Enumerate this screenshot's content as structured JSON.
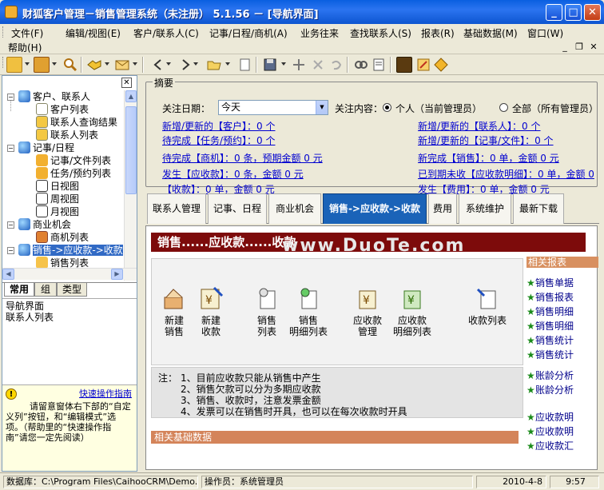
{
  "window": {
    "title": "财狐客户管理－销售管理系统（未注册） 5.1.56 － [导航界面]",
    "btn_min": "_",
    "btn_max": "□",
    "btn_close": "✕"
  },
  "menu": {
    "items": [
      "文件(F)",
      "编辑/视图(E)",
      "客户/联系人(C)",
      "记事/日程/商机(A)",
      "业务往来",
      "查找联系人(S)",
      "报表(R)",
      "基础数据(M)",
      "窗口(W)"
    ],
    "help": "帮助(H)",
    "mdi_min": "_",
    "mdi_restore": "❐",
    "mdi_close": "✕"
  },
  "left_panel": {
    "close": "✕",
    "tree": [
      {
        "label": "客户、联系人",
        "level": 0,
        "expanded": true,
        "icon": "globe-icon"
      },
      {
        "label": "客户列表",
        "level": 1,
        "icon": "house-icon"
      },
      {
        "label": "联系人查询结果",
        "level": 1,
        "icon": "card-icon"
      },
      {
        "label": "联系人列表",
        "level": 1,
        "icon": "card-icon"
      },
      {
        "label": "记事/日程",
        "level": 0,
        "expanded": true,
        "icon": "globe-icon"
      },
      {
        "label": "记事/文件列表",
        "level": 1,
        "icon": "pencil-icon"
      },
      {
        "label": "任务/预约列表",
        "level": 1,
        "icon": "pencil-icon"
      },
      {
        "label": "日视图",
        "level": 1,
        "icon": "calendar-icon"
      },
      {
        "label": "周视图",
        "level": 1,
        "icon": "calendar-icon"
      },
      {
        "label": "月视图",
        "level": 1,
        "icon": "calendar-icon"
      },
      {
        "label": "商业机会",
        "level": 0,
        "expanded": true,
        "icon": "globe-icon"
      },
      {
        "label": "商机列表",
        "level": 1,
        "icon": "chart-icon"
      },
      {
        "label": "销售->应收款->收款",
        "level": 0,
        "expanded": true,
        "selected": true,
        "icon": "globe-icon"
      },
      {
        "label": "销售列表",
        "level": 1,
        "icon": "hand-icon"
      }
    ],
    "tabs": [
      "常用",
      "组",
      "类型"
    ],
    "nav_items": [
      "导航界面",
      "联系人列表"
    ],
    "hint_link": "快速操作指南",
    "hint_text": "请留意窗体右下部的“自定义列”按钮，和“编辑模式”选项。（帮助里的“快速操作指南”请您一定先阅读）"
  },
  "summary": {
    "caption": "摘要",
    "focus_date_label": "关注日期：",
    "focus_date_value": "今天",
    "focus_content_label": "关注内容：",
    "radio_personal": "个人（当前管理员）",
    "radio_all": "全部（所有管理员）",
    "links_left": [
      "新增/更新的【客户】：0 个",
      "待完成【任务/预约】：0 个",
      "待完成【商机】：0 条，预期金额 0 元",
      "发生【应收款】：0 条，金额 0 元",
      "【收款】：0 单，金额 0 元"
    ],
    "links_right": [
      "新增/更新的【联系人】：0 个",
      "新增/更新的【记事/文件】：0 个",
      "新完成【销售】：0 单，金额 0 元",
      "已到期未收【应收款明细】：0 单，金额 0",
      "发生【费用】：0 单，金额 0 元"
    ]
  },
  "tabs": [
    "联系人管理",
    "记事、日程",
    "商业机会",
    "销售->应收款->收款",
    "费用",
    "系统维护",
    "最新下载"
  ],
  "content": {
    "banner": "销售......应收款......收款",
    "watermark": "www.DuoTe.com",
    "flow_items": [
      {
        "label1": "新建",
        "label2": "销售",
        "icon": "new-sale-icon"
      },
      {
        "label1": "新建",
        "label2": "收款",
        "icon": "new-receipt-icon"
      },
      {
        "label1": "销售",
        "label2": "列表",
        "icon": "sales-list-icon"
      },
      {
        "label1": "销售",
        "label2": "明细列表",
        "icon": "sales-detail-icon"
      },
      {
        "label1": "应收款",
        "label2": "管理",
        "icon": "receivable-icon"
      },
      {
        "label1": "应收款",
        "label2": "明细列表",
        "icon": "receivable-detail-icon"
      },
      {
        "label1": "收款列表",
        "label2": "",
        "icon": "receipt-list-icon"
      }
    ],
    "notes_label": "注：",
    "notes": [
      "1、目前应收款只能从销售中产生",
      "2、销售欠款可以分为多期应收款",
      "3、销售、收款时，注意发票金额",
      "4、发票可以在销售时开具，也可以在每次收款时开具"
    ],
    "related_reports_title": "相关报表",
    "related_reports": [
      "销售单据",
      "销售报表",
      "销售明细",
      "销售明细",
      "销售统计",
      "销售统计",
      "账龄分析",
      "账龄分析"
    ],
    "related_more": [
      "应收款明",
      "应收款明",
      "应收款汇"
    ],
    "base_data_title": "相关基础数据"
  },
  "status": {
    "db_label": "数据库：",
    "db_path": "C:\\Program Files\\CaihooCRM\\Demo.",
    "operator": "操作员：系统管理员",
    "date": "2010-4-8",
    "time": "9:57"
  },
  "colors": {
    "titlebar": "#0a5fe0",
    "selected_tab": "#1a63b8",
    "banner": "#7d0b0b",
    "link": "#0000d0",
    "section_bar": "#d4845a"
  }
}
